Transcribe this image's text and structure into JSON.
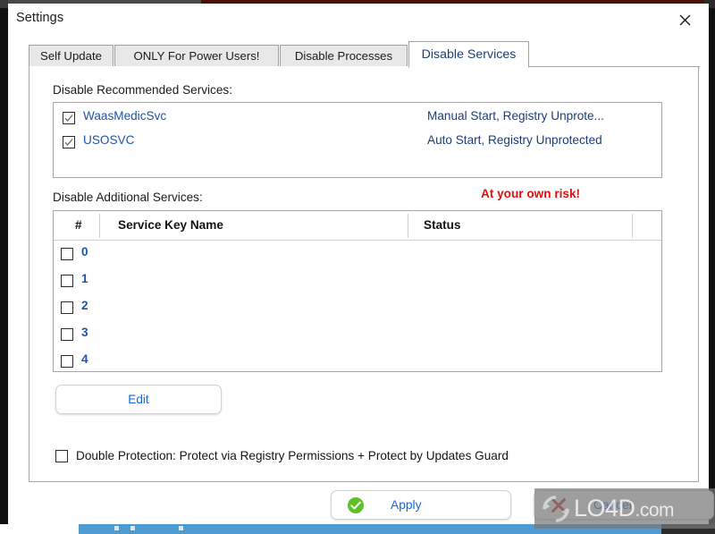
{
  "window": {
    "title": "Settings",
    "close_icon": "close-icon"
  },
  "tabs": [
    {
      "label": "Self Update",
      "active": false
    },
    {
      "label": "ONLY For Power Users!",
      "active": false
    },
    {
      "label": "Disable Processes",
      "active": false
    },
    {
      "label": "Disable Services",
      "active": true
    }
  ],
  "recommended": {
    "label": "Disable Recommended Services:",
    "items": [
      {
        "name": "WaasMedicSvc",
        "status": "Manual Start, Registry Unprote...",
        "checked": true
      },
      {
        "name": "USOSVC",
        "status": "Auto Start, Registry Unprotected",
        "checked": true
      }
    ]
  },
  "additional": {
    "label": "Disable Additional Services:",
    "warning": "At your own risk!",
    "columns": [
      "#",
      "Service Key Name",
      "Status"
    ],
    "rows": [
      {
        "num": "0",
        "name": "",
        "status": "",
        "checked": false
      },
      {
        "num": "1",
        "name": "",
        "status": "",
        "checked": false
      },
      {
        "num": "2",
        "name": "",
        "status": "",
        "checked": false
      },
      {
        "num": "3",
        "name": "",
        "status": "",
        "checked": false
      },
      {
        "num": "4",
        "name": "",
        "status": "",
        "checked": false
      }
    ]
  },
  "edit_button": {
    "label": "Edit"
  },
  "double_protection": {
    "label": "Double Protection: Protect via Registry Permissions + Protect by Updates Guard",
    "checked": false
  },
  "footer": {
    "apply": {
      "label": "Apply",
      "icon": "green-check-circle-icon"
    },
    "cancel": {
      "label": "Cancel",
      "icon": "red-x-icon"
    }
  },
  "watermark": {
    "text": "LO4D",
    "suffix": ".com",
    "logo": "refresh-arrows-icon"
  },
  "colors": {
    "link_blue": "#1666e0",
    "text_blue": "#1f3c7a",
    "warning_red": "#e01010",
    "apply_green": "#5ec12a",
    "cancel_red": "#d32020",
    "panel_border": "#a6a6a6"
  }
}
